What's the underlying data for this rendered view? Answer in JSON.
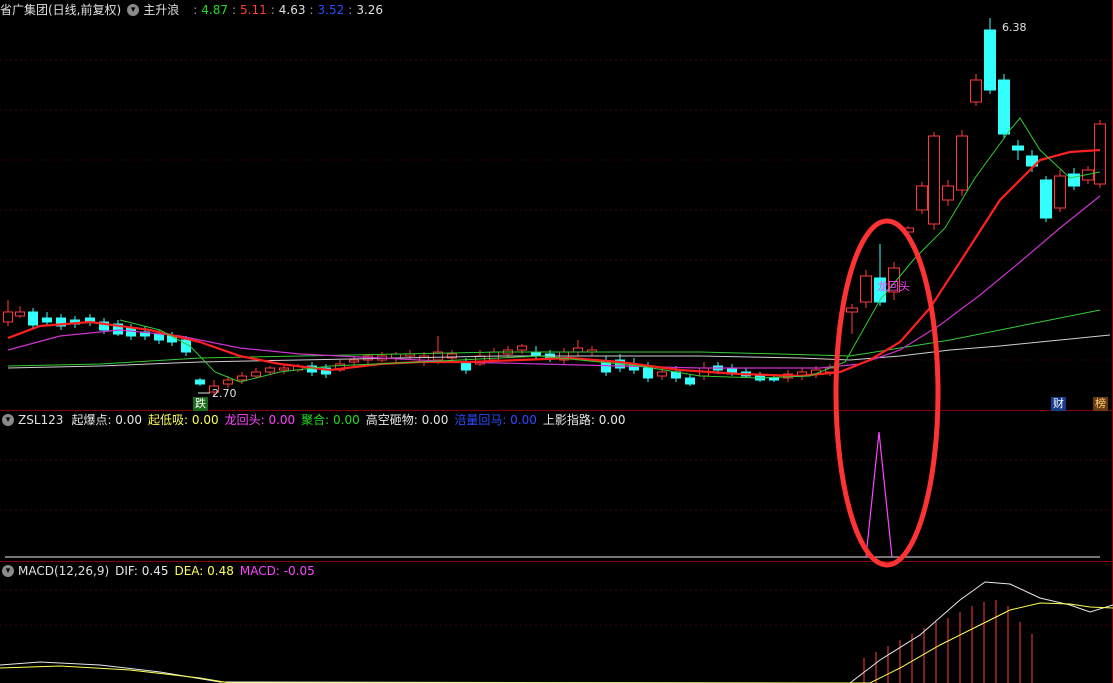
{
  "main_header": {
    "title": "省广集团(日线,前复权)",
    "indicator": "主升浪",
    "values": [
      "4.87",
      "5.11",
      "4.63",
      "3.52",
      "3.26"
    ],
    "value_colors": [
      "#22dd22",
      "#ff3b3b",
      "#e0e0e0",
      "#2a4cff",
      "#e0e0e0"
    ]
  },
  "price_labels": {
    "high": "6.38",
    "low": "2.70"
  },
  "signals": {
    "dragon": "龙回头",
    "fall": "跌",
    "cai": "财",
    "bang": "榜"
  },
  "zsl_header": {
    "name": "ZSL123",
    "items": [
      {
        "label": "起爆点: 0.00",
        "color": "#e8e8e8"
      },
      {
        "label": "起低吸: 0.00",
        "color": "#ffff55"
      },
      {
        "label": "龙回头: 0.00",
        "color": "#ff44ff"
      },
      {
        "label": "聚合: 0.00",
        "color": "#22dd22"
      },
      {
        "label": "高空砸物: 0.00",
        "color": "#e8e8e8"
      },
      {
        "label": "涪量回马: 0.00",
        "color": "#2a4cff"
      },
      {
        "label": "上影指路: 0.00",
        "color": "#e8e8e8"
      }
    ]
  },
  "macd_header": {
    "name": "MACD(12,26,9)",
    "dif": "DIF: 0.45",
    "dea": "DEA: 0.48",
    "macd": "MACD: -0.05"
  },
  "colors": {
    "up": "#ff3a3a",
    "down": "#33ffff",
    "ma5": "#e8e8e8",
    "ma10": "#ffff55",
    "ma_red": "#ff2020",
    "ma_green": "#33cc33",
    "ma_magenta": "#cc33cc",
    "ma_gray": "#d0d0d0",
    "annotation": "#ff3333"
  }
}
